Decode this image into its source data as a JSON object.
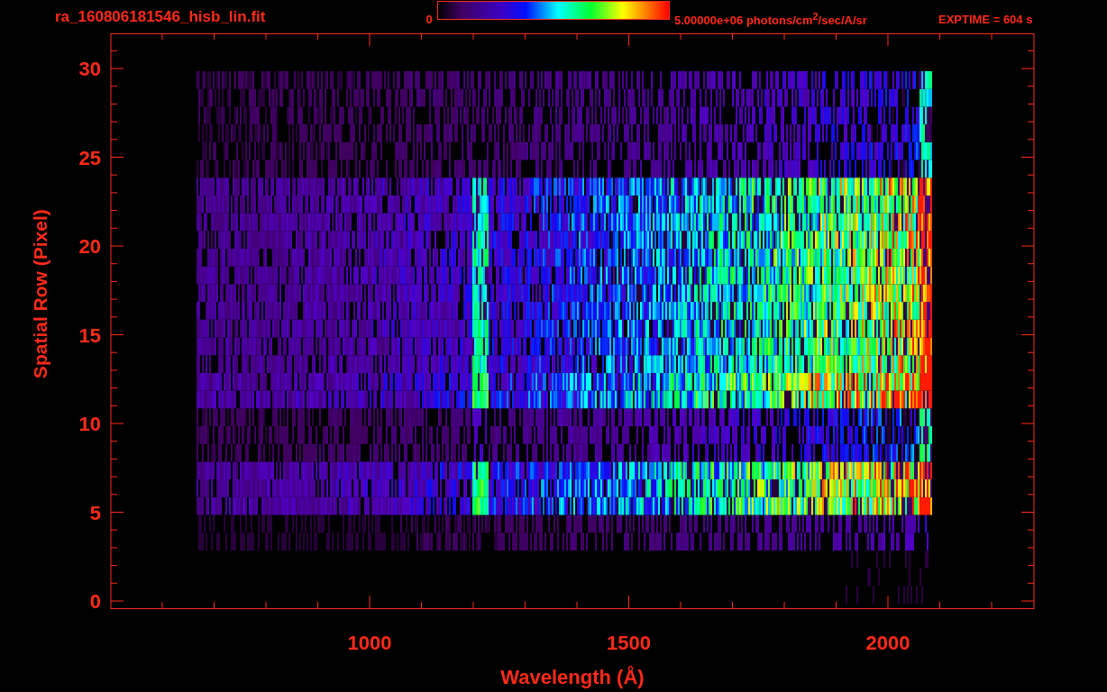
{
  "title": "ra_160806181546_hisb_lin.fit",
  "colorbar": {
    "min_label": "0",
    "max_label": "5.00000e+06 photons/cm$^{2}$/sec/A/sr"
  },
  "exposure": "EXPTIME = 604 s",
  "plot": {
    "x_axis": {
      "label": "Wavelength (Å)",
      "ticks": [
        "1000",
        "1500",
        "2000"
      ]
    },
    "y_axis": {
      "label": "Spatial Row (Pixel)",
      "ticks": [
        "30",
        "25",
        "20",
        "15",
        "10",
        "5",
        "0"
      ]
    }
  }
}
